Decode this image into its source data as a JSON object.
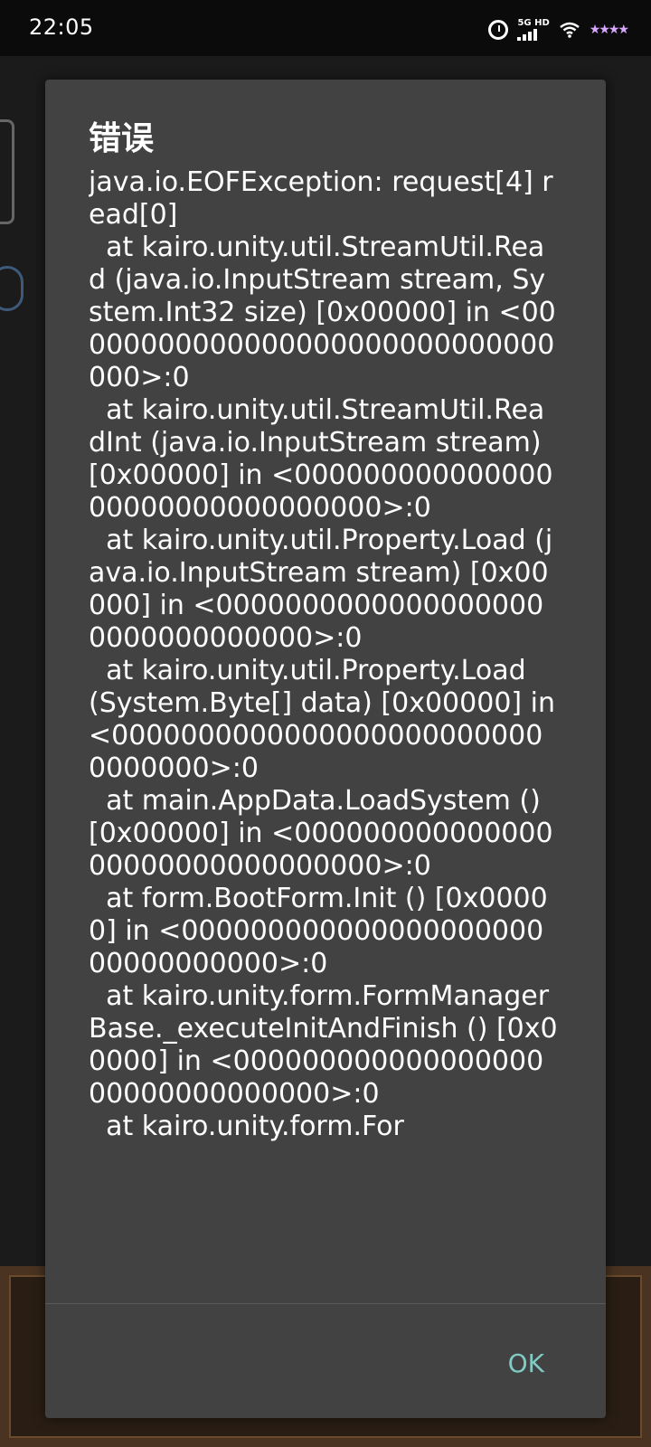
{
  "status_bar": {
    "time": "22:05",
    "network_label": "5G HD",
    "icons": [
      "alarm-icon",
      "signal-icon",
      "wifi-icon",
      "stars-icon"
    ]
  },
  "dialog": {
    "title": "错误",
    "message": "java.io.EOFException: request[4] read[0]\n  at kairo.unity.util.StreamUtil.Read (java.io.InputStream stream, System.Int32 size) [0x00000] in <00000000000000000000000000000000>:0\n  at kairo.unity.util.StreamUtil.ReadInt (java.io.InputStream stream) [0x00000] in <00000000000000000000000000000000>:0\n  at kairo.unity.util.Property.Load (java.io.InputStream stream) [0x00000] in <00000000000000000000000000000000>:0\n  at kairo.unity.util.Property.Load (System.Byte[] data) [0x00000] in <00000000000000000000000000000000>:0\n  at main.AppData.LoadSystem () [0x00000] in <00000000000000000000000000000000>:0\n  at form.BootForm.Init () [0x00000] in <00000000000000000000000000000000>:0\n  at kairo.unity.form.FormManagerBase._executeInitAndFinish () [0x00000] in <00000000000000000000000000000000>:0\n  at kairo.unity.form.For",
    "ok_label": "OK"
  },
  "colors": {
    "dialog_bg": "#424242",
    "button_accent": "#80cbc4"
  }
}
